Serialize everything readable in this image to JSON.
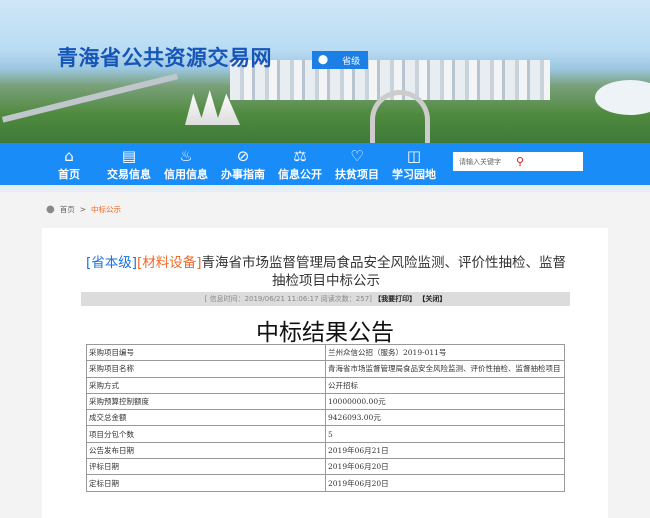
{
  "header": {
    "site_title": "青海省公共资源交易网",
    "level_button": "省级"
  },
  "nav": {
    "items": [
      {
        "label": "首页",
        "icon": "home-icon"
      },
      {
        "label": "交易信息",
        "icon": "document-icon"
      },
      {
        "label": "信用信息",
        "icon": "hand-heart-icon"
      },
      {
        "label": "办事指南",
        "icon": "compass-icon"
      },
      {
        "label": "信息公开",
        "icon": "scale-icon"
      },
      {
        "label": "扶贫项目",
        "icon": "heart-hands-icon"
      },
      {
        "label": "学习园地",
        "icon": "book-icon"
      }
    ],
    "search_placeholder": "请输入关键字"
  },
  "breadcrumb": {
    "home": "首页",
    "sep": ">",
    "current": "中标公示"
  },
  "article": {
    "tag1": "[省本级]",
    "tag2": "[材料设备]",
    "title": "青海省市场监督管理局食品安全风险监测、评价性抽检、监督抽检项目中标公示",
    "info": "[ 信息时间：2019/06/21 11:06:17  阅读次数：257]",
    "print": "【我要打印】",
    "close": "【关闭】",
    "heading": "中标结果公告",
    "rows": [
      [
        "采购项目编号",
        "兰州众信公招（服务）2019-011号"
      ],
      [
        "采购项目名称",
        "青海省市场监督管理局食品安全风险监测、评价性抽检、监督抽检项目"
      ],
      [
        "采购方式",
        "公开招标"
      ],
      [
        "采购预算控制额度",
        "10000000.00元"
      ],
      [
        "成交总金额",
        "9426093.00元"
      ],
      [
        "项目分包个数",
        "5"
      ],
      [
        "公告发布日期",
        "2019年06月21日"
      ],
      [
        "评标日期",
        "2019年06月20日"
      ],
      [
        "定标日期",
        "2019年06月20日"
      ]
    ]
  },
  "colors": {
    "nav": "#1a8cf8",
    "accent": "#f06a2a",
    "tag": "#1a73e8"
  }
}
